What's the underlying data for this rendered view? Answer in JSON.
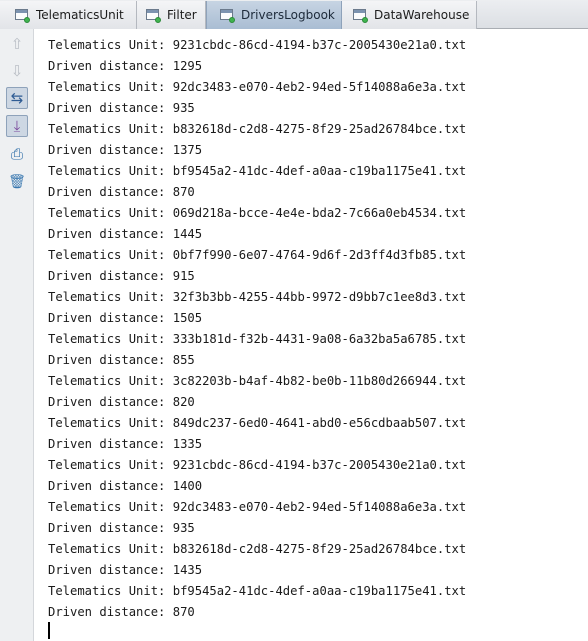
{
  "tabs": [
    {
      "label": "TelematicsUnit",
      "active": false
    },
    {
      "label": "Filter",
      "active": false
    },
    {
      "label": "DriversLogbook",
      "active": true
    },
    {
      "label": "DataWarehouse",
      "active": false
    }
  ],
  "toolbar": {
    "buttons": [
      {
        "name": "scroll-up-icon",
        "glyph": "⇧"
      },
      {
        "name": "scroll-down-icon",
        "glyph": "⇩"
      },
      {
        "name": "soft-wrap-icon",
        "glyph": "⇆"
      },
      {
        "name": "scroll-to-end-icon",
        "glyph": "⤓"
      },
      {
        "name": "print-icon",
        "glyph": "⎙"
      },
      {
        "name": "trash-icon",
        "glyph": "🗑"
      }
    ]
  },
  "console": {
    "lines": [
      "Telematics Unit: 9231cbdc-86cd-4194-b37c-2005430e21a0.txt",
      "Driven distance: 1295",
      "Telematics Unit: 92dc3483-e070-4eb2-94ed-5f14088a6e3a.txt",
      "Driven distance: 935",
      "Telematics Unit: b832618d-c2d8-4275-8f29-25ad26784bce.txt",
      "Driven distance: 1375",
      "Telematics Unit: bf9545a2-41dc-4def-a0aa-c19ba1175e41.txt",
      "Driven distance: 870",
      "Telematics Unit: 069d218a-bcce-4e4e-bda2-7c66a0eb4534.txt",
      "Driven distance: 1445",
      "Telematics Unit: 0bf7f990-6e07-4764-9d6f-2d3ff4d3fb85.txt",
      "Driven distance: 915",
      "Telematics Unit: 32f3b3bb-4255-44bb-9972-d9bb7c1ee8d3.txt",
      "Driven distance: 1505",
      "Telematics Unit: 333b181d-f32b-4431-9a08-6a32ba5a6785.txt",
      "Driven distance: 855",
      "Telematics Unit: 3c82203b-b4af-4b82-be0b-11b80d266944.txt",
      "Driven distance: 820",
      "Telematics Unit: 849dc237-6ed0-4641-abd0-e56cdbaab507.txt",
      "Driven distance: 1335",
      "Telematics Unit: 9231cbdc-86cd-4194-b37c-2005430e21a0.txt",
      "Driven distance: 1400",
      "Telematics Unit: 92dc3483-e070-4eb2-94ed-5f14088a6e3a.txt",
      "Driven distance: 935",
      "Telematics Unit: b832618d-c2d8-4275-8f29-25ad26784bce.txt",
      "Driven distance: 1435",
      "Telematics Unit: bf9545a2-41dc-4def-a0aa-c19ba1175e41.txt",
      "Driven distance: 870"
    ]
  }
}
